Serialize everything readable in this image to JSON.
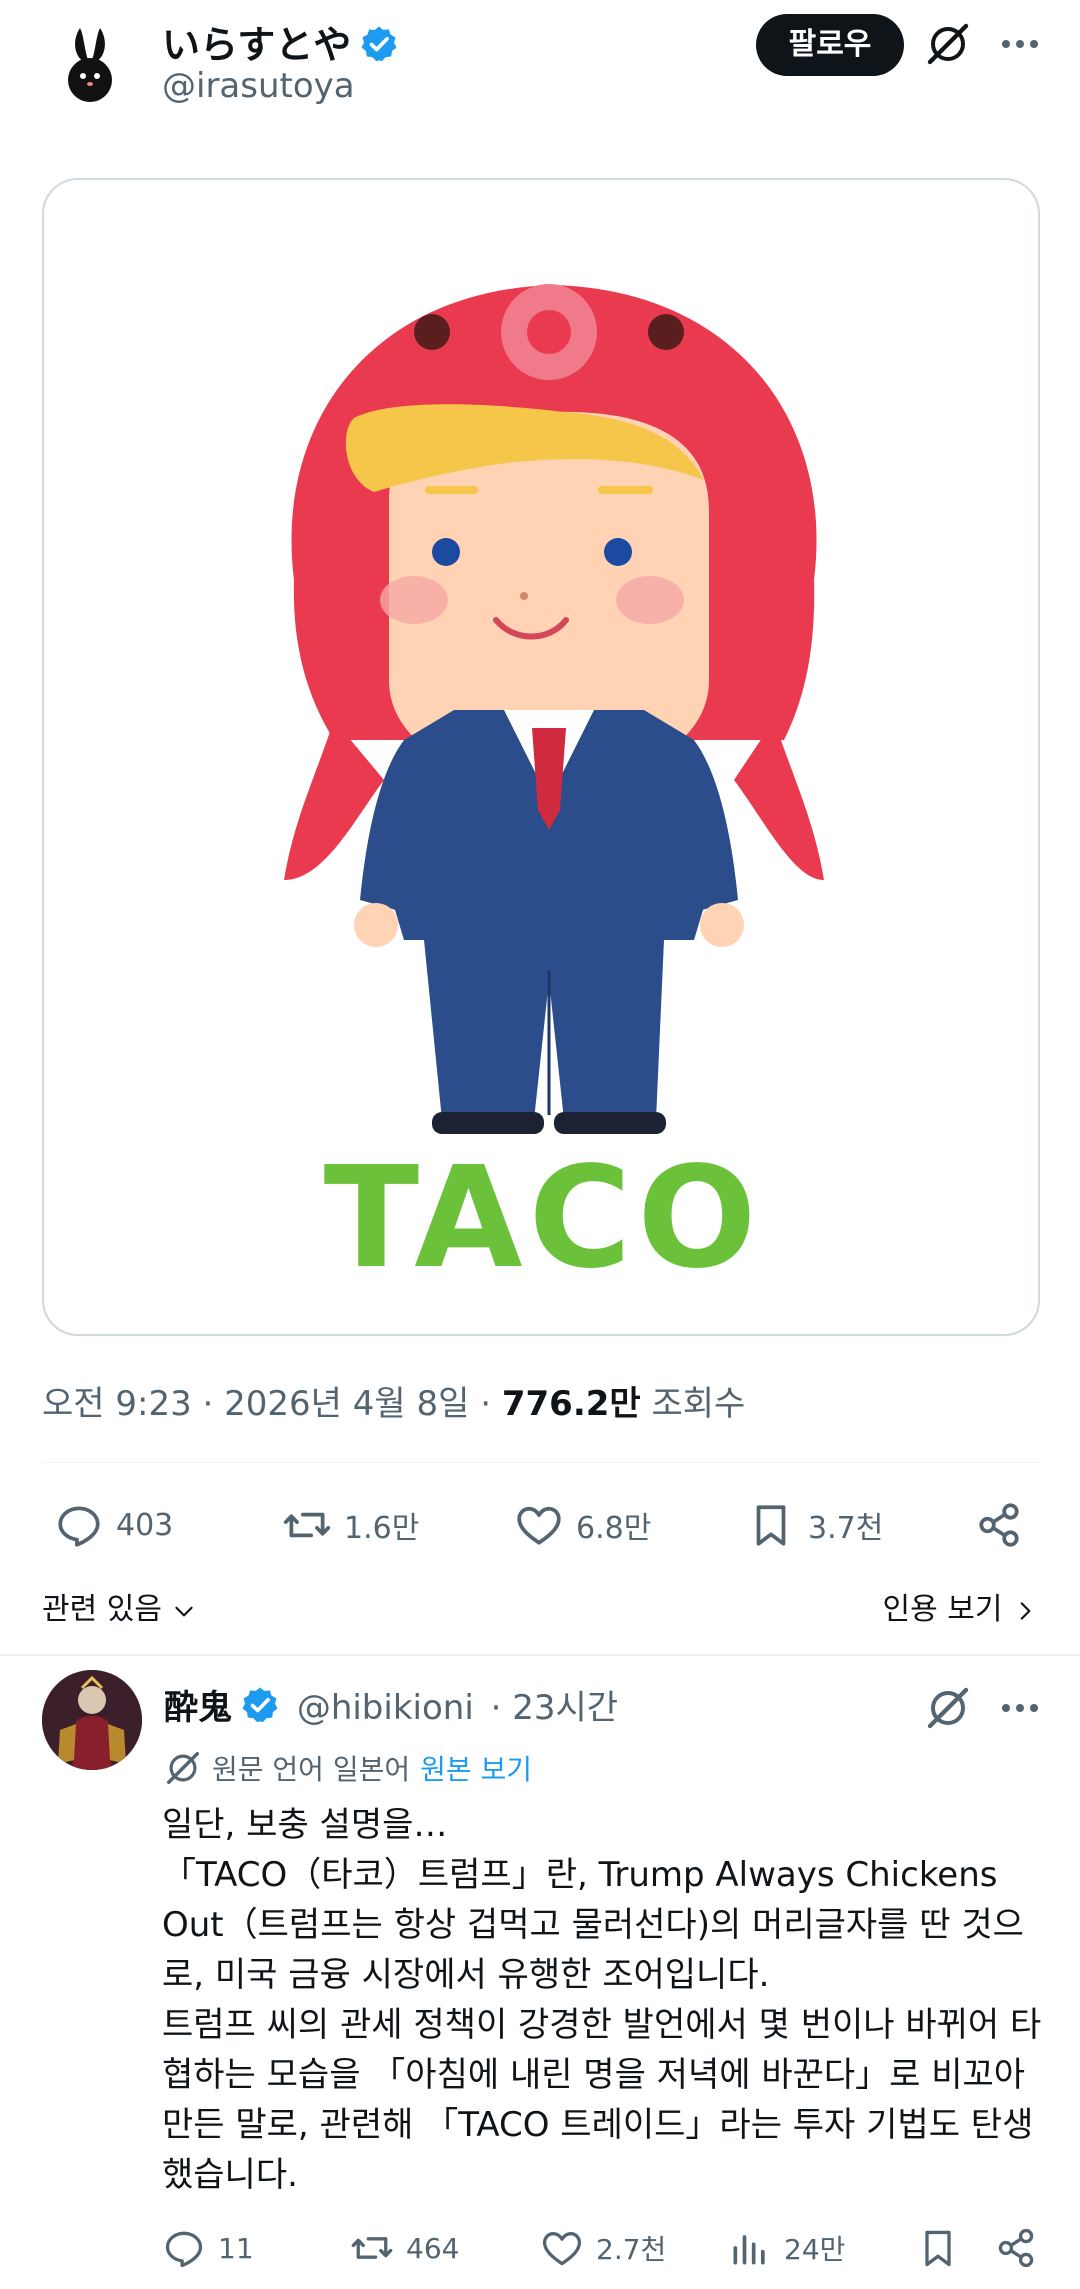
{
  "post": {
    "author_name": "いらすとや",
    "author_handle": "@irasutoya",
    "follow_label": "팔로우",
    "image_caption": "TACO",
    "time": "오전 9:23",
    "date": "2026년 4월 8일",
    "views_value": "776.2만",
    "views_label": "조회수",
    "separator": "·",
    "stats": {
      "replies": "403",
      "reposts": "1.6만",
      "likes": "6.8만",
      "bookmarks": "3.7천"
    },
    "related_label": "관련 있음",
    "quotes_label": "인용 보기"
  },
  "reply": {
    "author_name": "酔鬼",
    "author_handle": "@hibikioni",
    "time": "23시간",
    "translation_note": "원문 언어 일본어",
    "translation_link": "원본 보기",
    "lines": [
      "일단, 보충 설명을…",
      "「TACO（타코）트럼프」란, Trump Always Chickens Out（트럼프는 항상 겁먹고 물러선다)의 머리글자를 딴 것으로, 미국 금융 시장에서 유행한 조어입니다.",
      "트럼프 씨의 관세 정책이 강경한 발언에서 몇 번이나 바뀌어 타협하는 모습을 「아침에 내린 명을 저녁에 바꾼다」로 비꼬아 만든 말로, 관련해 「TACO 트레이드」라는 투자 기법도 탄생했습니다."
    ],
    "stats": {
      "replies": "11",
      "reposts": "464",
      "likes": "2.7천",
      "views": "24만"
    }
  },
  "colors": {
    "text": "#0f1419",
    "secondary": "#536471",
    "link": "#1d9bf0",
    "verified": "#1d9bf0",
    "taco_green": "#6cc13a",
    "octopus_red": "#e93a4f",
    "suit_blue": "#2c4d8c"
  },
  "icons": [
    "verified-badge-icon",
    "grok-icon",
    "more-icon",
    "reply-icon",
    "repost-icon",
    "like-icon",
    "bookmark-icon",
    "share-icon",
    "chevron-down-icon",
    "chevron-right-icon",
    "translate-icon",
    "views-icon"
  ]
}
